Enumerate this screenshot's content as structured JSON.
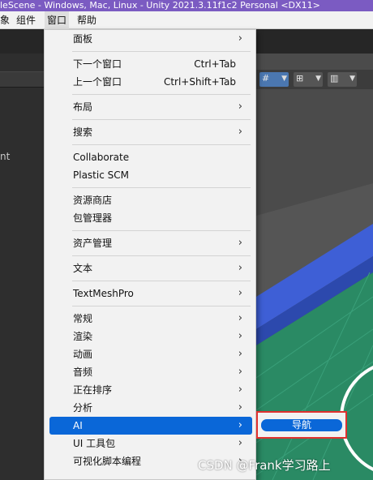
{
  "window": {
    "title": "leScene - Windows, Mac, Linux - Unity 2021.3.11f1c2 Personal <DX11>"
  },
  "menubar": {
    "items": [
      "象",
      "组件",
      "窗口",
      "帮助"
    ],
    "active_index": 2
  },
  "editor": {
    "truncated_label": "nt"
  },
  "window_menu": {
    "items": [
      {
        "label": "面板",
        "arrow": "›"
      },
      {
        "label": "下一个窗口",
        "shortcut": "Ctrl+Tab"
      },
      {
        "label": "上一个窗口",
        "shortcut": "Ctrl+Shift+Tab"
      },
      {
        "label": "布局",
        "arrow": "›"
      },
      {
        "label": "搜索",
        "arrow": "›"
      },
      {
        "label": "Collaborate"
      },
      {
        "label": "Plastic SCM"
      },
      {
        "label": "资源商店"
      },
      {
        "label": "包管理器"
      },
      {
        "label": "资产管理",
        "arrow": "›"
      },
      {
        "label": "文本",
        "arrow": "›"
      },
      {
        "label": "TextMeshPro",
        "arrow": "›"
      },
      {
        "label": "常规",
        "arrow": "›"
      },
      {
        "label": "渲染",
        "arrow": "›"
      },
      {
        "label": "动画",
        "arrow": "›"
      },
      {
        "label": "音频",
        "arrow": "›"
      },
      {
        "label": "正在排序",
        "arrow": "›"
      },
      {
        "label": "分析",
        "arrow": "›"
      },
      {
        "label": "AI",
        "arrow": "›"
      },
      {
        "label": "UI 工具包",
        "arrow": "›"
      },
      {
        "label": "可视化脚本编程",
        "arrow": "›"
      }
    ],
    "highlighted": "AI"
  },
  "submenu": {
    "items": [
      "导航"
    ]
  },
  "scene_toolbar": {
    "icons": [
      "grid-snap-icon",
      "grid-icon",
      "view-options-icon"
    ]
  },
  "watermark": "CSDN @Frank学习路上",
  "colors": {
    "accent": "#0a67d8",
    "title_bar": "#7b5bc2",
    "highlight_border": "#e0312f"
  }
}
